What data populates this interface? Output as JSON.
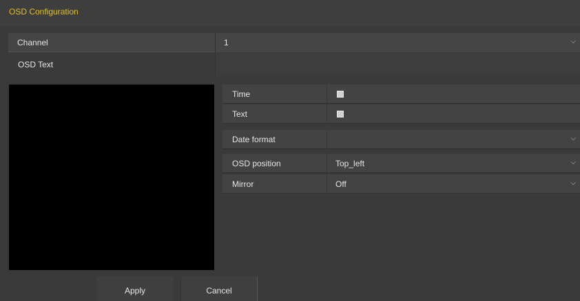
{
  "title": "OSD Configuration",
  "channel": {
    "label": "Channel",
    "value": "1"
  },
  "osd_text": {
    "label": "OSD Text",
    "value": ""
  },
  "panel": {
    "time": {
      "label": "Time",
      "checked": true
    },
    "text": {
      "label": "Text",
      "checked": true
    },
    "date_format": {
      "label": "Date format",
      "value": ""
    },
    "osd_position": {
      "label": "OSD position",
      "value": "Top_left"
    },
    "mirror": {
      "label": "Mirror",
      "value": "Off"
    }
  },
  "buttons": {
    "apply": "Apply",
    "cancel": "Cancel"
  },
  "colors": {
    "title": "#e3c21d",
    "background": "#3a3a3a"
  },
  "icons": {
    "dropdown": "chevron-down-icon",
    "checkbox": "checkbox-icon"
  }
}
